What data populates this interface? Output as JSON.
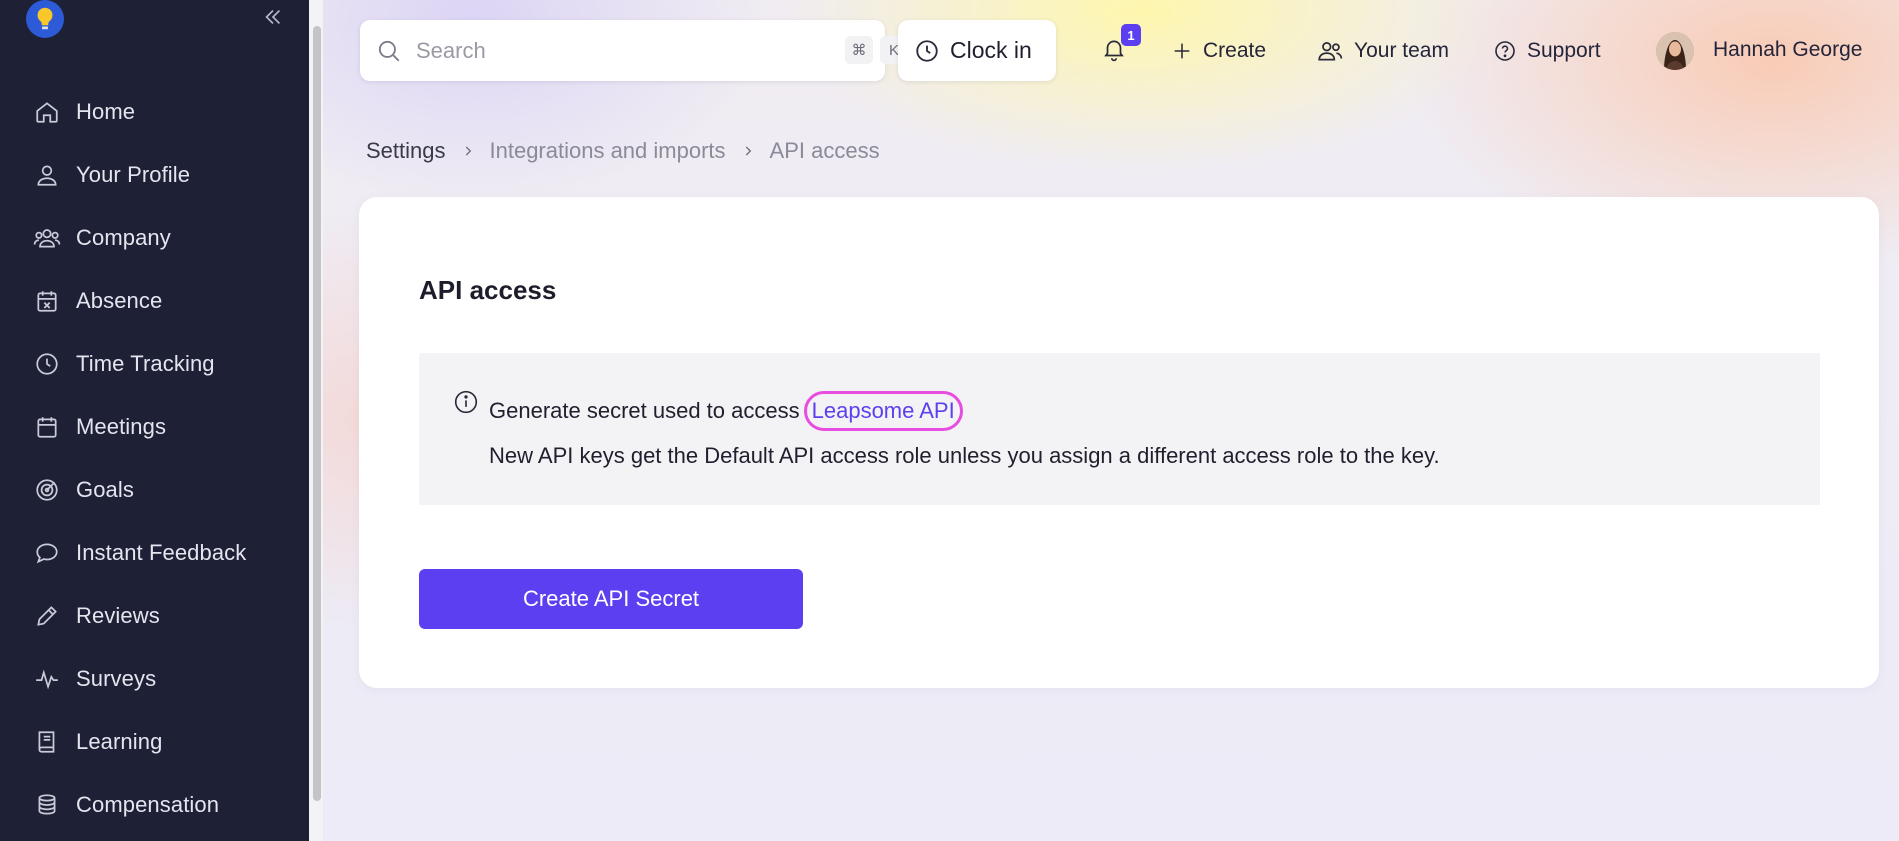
{
  "sidebar": {
    "items": [
      {
        "label": "Home",
        "icon": "home-icon"
      },
      {
        "label": "Your Profile",
        "icon": "user-icon"
      },
      {
        "label": "Company",
        "icon": "people-icon"
      },
      {
        "label": "Absence",
        "icon": "calendar-x-icon"
      },
      {
        "label": "Time Tracking",
        "icon": "clock-icon"
      },
      {
        "label": "Meetings",
        "icon": "calendar-icon"
      },
      {
        "label": "Goals",
        "icon": "target-icon"
      },
      {
        "label": "Instant Feedback",
        "icon": "speech-bubble-icon"
      },
      {
        "label": "Reviews",
        "icon": "pencil-icon"
      },
      {
        "label": "Surveys",
        "icon": "pulse-icon"
      },
      {
        "label": "Learning",
        "icon": "book-icon"
      },
      {
        "label": "Compensation",
        "icon": "coins-icon"
      }
    ]
  },
  "header": {
    "search_placeholder": "Search",
    "shortcut_cmd": "⌘",
    "shortcut_key": "K",
    "clock_in_label": "Clock in",
    "notification_count": "1",
    "create_label": "Create",
    "team_label": "Your team",
    "support_label": "Support",
    "user_name": "Hannah George"
  },
  "breadcrumb": [
    "Settings",
    "Integrations and imports",
    "API access"
  ],
  "card": {
    "title": "API access",
    "info_text": "Generate secret used to access",
    "info_link": "Leapsome API",
    "info_note": "New API keys get the Default API access role unless you assign a different access role to the key.",
    "button_label": "Create API Secret"
  },
  "colors": {
    "sidebar_bg": "#1e2036",
    "accent": "#5b3ff0",
    "link_highlight": "#e64de0"
  }
}
